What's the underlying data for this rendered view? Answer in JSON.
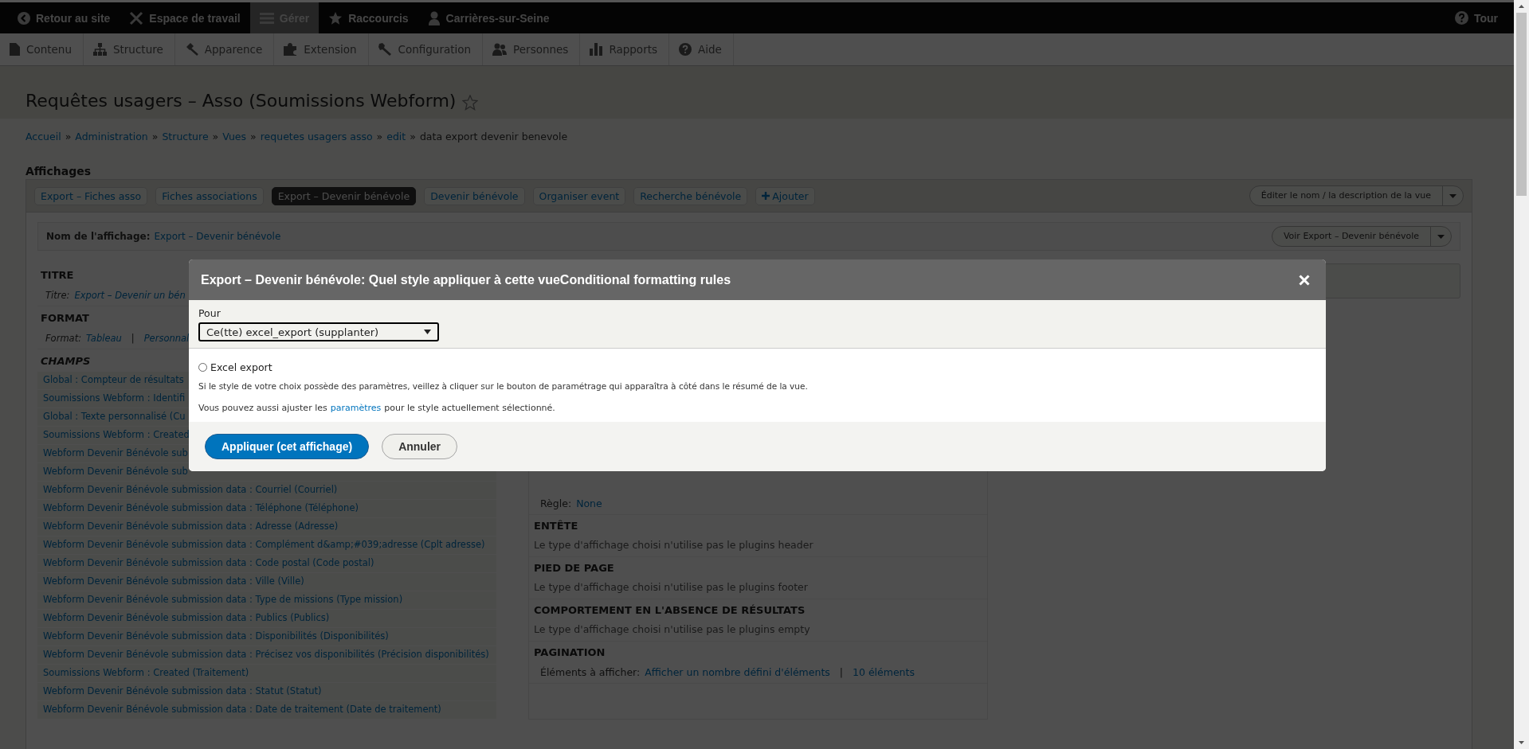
{
  "toolbar": {
    "items": [
      {
        "label": "Retour au site",
        "selected": false
      },
      {
        "label": "Espace de travail",
        "selected": false
      },
      {
        "label": "Gérer",
        "selected": true
      },
      {
        "label": "Raccourcis",
        "selected": false
      },
      {
        "label": "Carrières-sur-Seine",
        "selected": false
      }
    ],
    "tour": "Tour"
  },
  "admin_menu": [
    "Contenu",
    "Structure",
    "Apparence",
    "Extension",
    "Configuration",
    "Personnes",
    "Rapports",
    "Aide"
  ],
  "page": {
    "title": "Requêtes usagers – Asso (Soumissions Webform)",
    "favorite": false,
    "breadcrumb": [
      {
        "label": "Accueil",
        "link": true
      },
      {
        "label": "Administration",
        "link": true
      },
      {
        "label": "Structure",
        "link": true
      },
      {
        "label": "Vues",
        "link": true
      },
      {
        "label": "requetes usagers asso",
        "link": true
      },
      {
        "label": "edit",
        "link": true
      },
      {
        "label": "data export devenir benevole",
        "link": false
      }
    ],
    "separator": "»"
  },
  "displays": {
    "heading": "Affichages",
    "tabs": [
      {
        "label": "Export – Fiches asso",
        "selected": false
      },
      {
        "label": "Fiches associations",
        "selected": false
      },
      {
        "label": "Export – Devenir bénévole",
        "selected": true
      },
      {
        "label": "Devenir bénévole",
        "selected": false
      },
      {
        "label": "Organiser event",
        "selected": false
      },
      {
        "label": "Recherche bénévole",
        "selected": false
      }
    ],
    "add": "Ajouter",
    "edit_view": "Éditer le nom / la description de la vue",
    "display_name": {
      "label": "Nom de l'affichage:",
      "value": "Export – Devenir bénévole"
    },
    "view_button": "Voir Export – Devenir bénévole"
  },
  "left_column": {
    "sections": [
      {
        "heading": "TITRE",
        "kind": "setting",
        "field": {
          "label": "Titre:",
          "values": [
            "Export – Devenir un bén"
          ],
          "defaulted": true
        }
      },
      {
        "heading": "FORMAT",
        "kind": "setting",
        "field": {
          "label": "Format:",
          "values": [
            "Tableau",
            "Personnal"
          ],
          "separator": "|",
          "defaulted": true
        }
      },
      {
        "heading": "CHAMPS",
        "kind": "fields",
        "items": [
          "Global : Compteur de résultats",
          "Soumissions Webform : Identifi",
          "Global : Texte personnalisé (Cu",
          "Soumissions Webform : Created",
          "Webform Devenir Bénévole sub",
          "Webform Devenir Bénévole sub",
          "Webform Devenir Bénévole submission data : Courriel (Courriel)",
          "Webform Devenir Bénévole submission data : Téléphone (Téléphone)",
          "Webform Devenir Bénévole submission data : Adresse (Adresse)",
          "Webform Devenir Bénévole submission data : Complément d&amp;#039;adresse (Cplt adresse)",
          "Webform Devenir Bénévole submission data : Code postal (Code postal)",
          "Webform Devenir Bénévole submission data : Ville (Ville)",
          "Webform Devenir Bénévole submission data : Type de missions (Type mission)",
          "Webform Devenir Bénévole submission data : Publics (Publics)",
          "Webform Devenir Bénévole submission data : Disponibilités (Disponibilités)",
          "Webform Devenir Bénévole submission data : Précisez vos disponibilités (Précision disponibilités)",
          "Soumissions Webform : Created (Traitement)",
          "Webform Devenir Bénévole submission data : Statut (Statut)",
          "Webform Devenir Bénévole submission data : Date de traitement (Date de traitement)"
        ]
      }
    ]
  },
  "middle_column": {
    "rule": {
      "label": "Règle:",
      "values": [
        "None"
      ],
      "defaulted": false
    },
    "sections": [
      {
        "heading": "ENTÊTE",
        "text": "Le type d'affichage choisi n'utilise pas le plugins header"
      },
      {
        "heading": "PIED DE PAGE",
        "text": "Le type d'affichage choisi n'utilise pas le plugins footer"
      },
      {
        "heading": "COMPORTEMENT EN L'ABSENCE DE RÉSULTATS",
        "text": "Le type d'affichage choisi n'utilise pas le plugins empty"
      },
      {
        "heading": "PAGINATION",
        "field": {
          "label": "Éléments à afficher:",
          "values": [
            "Afficher un nombre défini d'éléments",
            "10 éléments"
          ],
          "separator": "|",
          "defaulted": false
        }
      }
    ]
  },
  "modal": {
    "title": "Export – Devenir bénévole: Quel style appliquer à cette vueConditional formatting rules",
    "for_label": "Pour",
    "for_value": "Ce(tte) excel_export (supplanter)",
    "options": [
      {
        "label": "Excel export",
        "selected": false
      }
    ],
    "help": "Si le style de votre choix possède des paramètres, veillez à cliquer sur le bouton de paramétrage qui apparaîtra à côté dans le résumé de la vue.",
    "note_before": "Vous pouvez aussi ajuster les",
    "note_link": "paramètres",
    "note_after": "pour le style actuellement sélectionné.",
    "buttons": [
      {
        "label": "Appliquer (cet affichage)",
        "kind": "primary"
      },
      {
        "label": "Annuler",
        "kind": "secondary"
      }
    ]
  }
}
